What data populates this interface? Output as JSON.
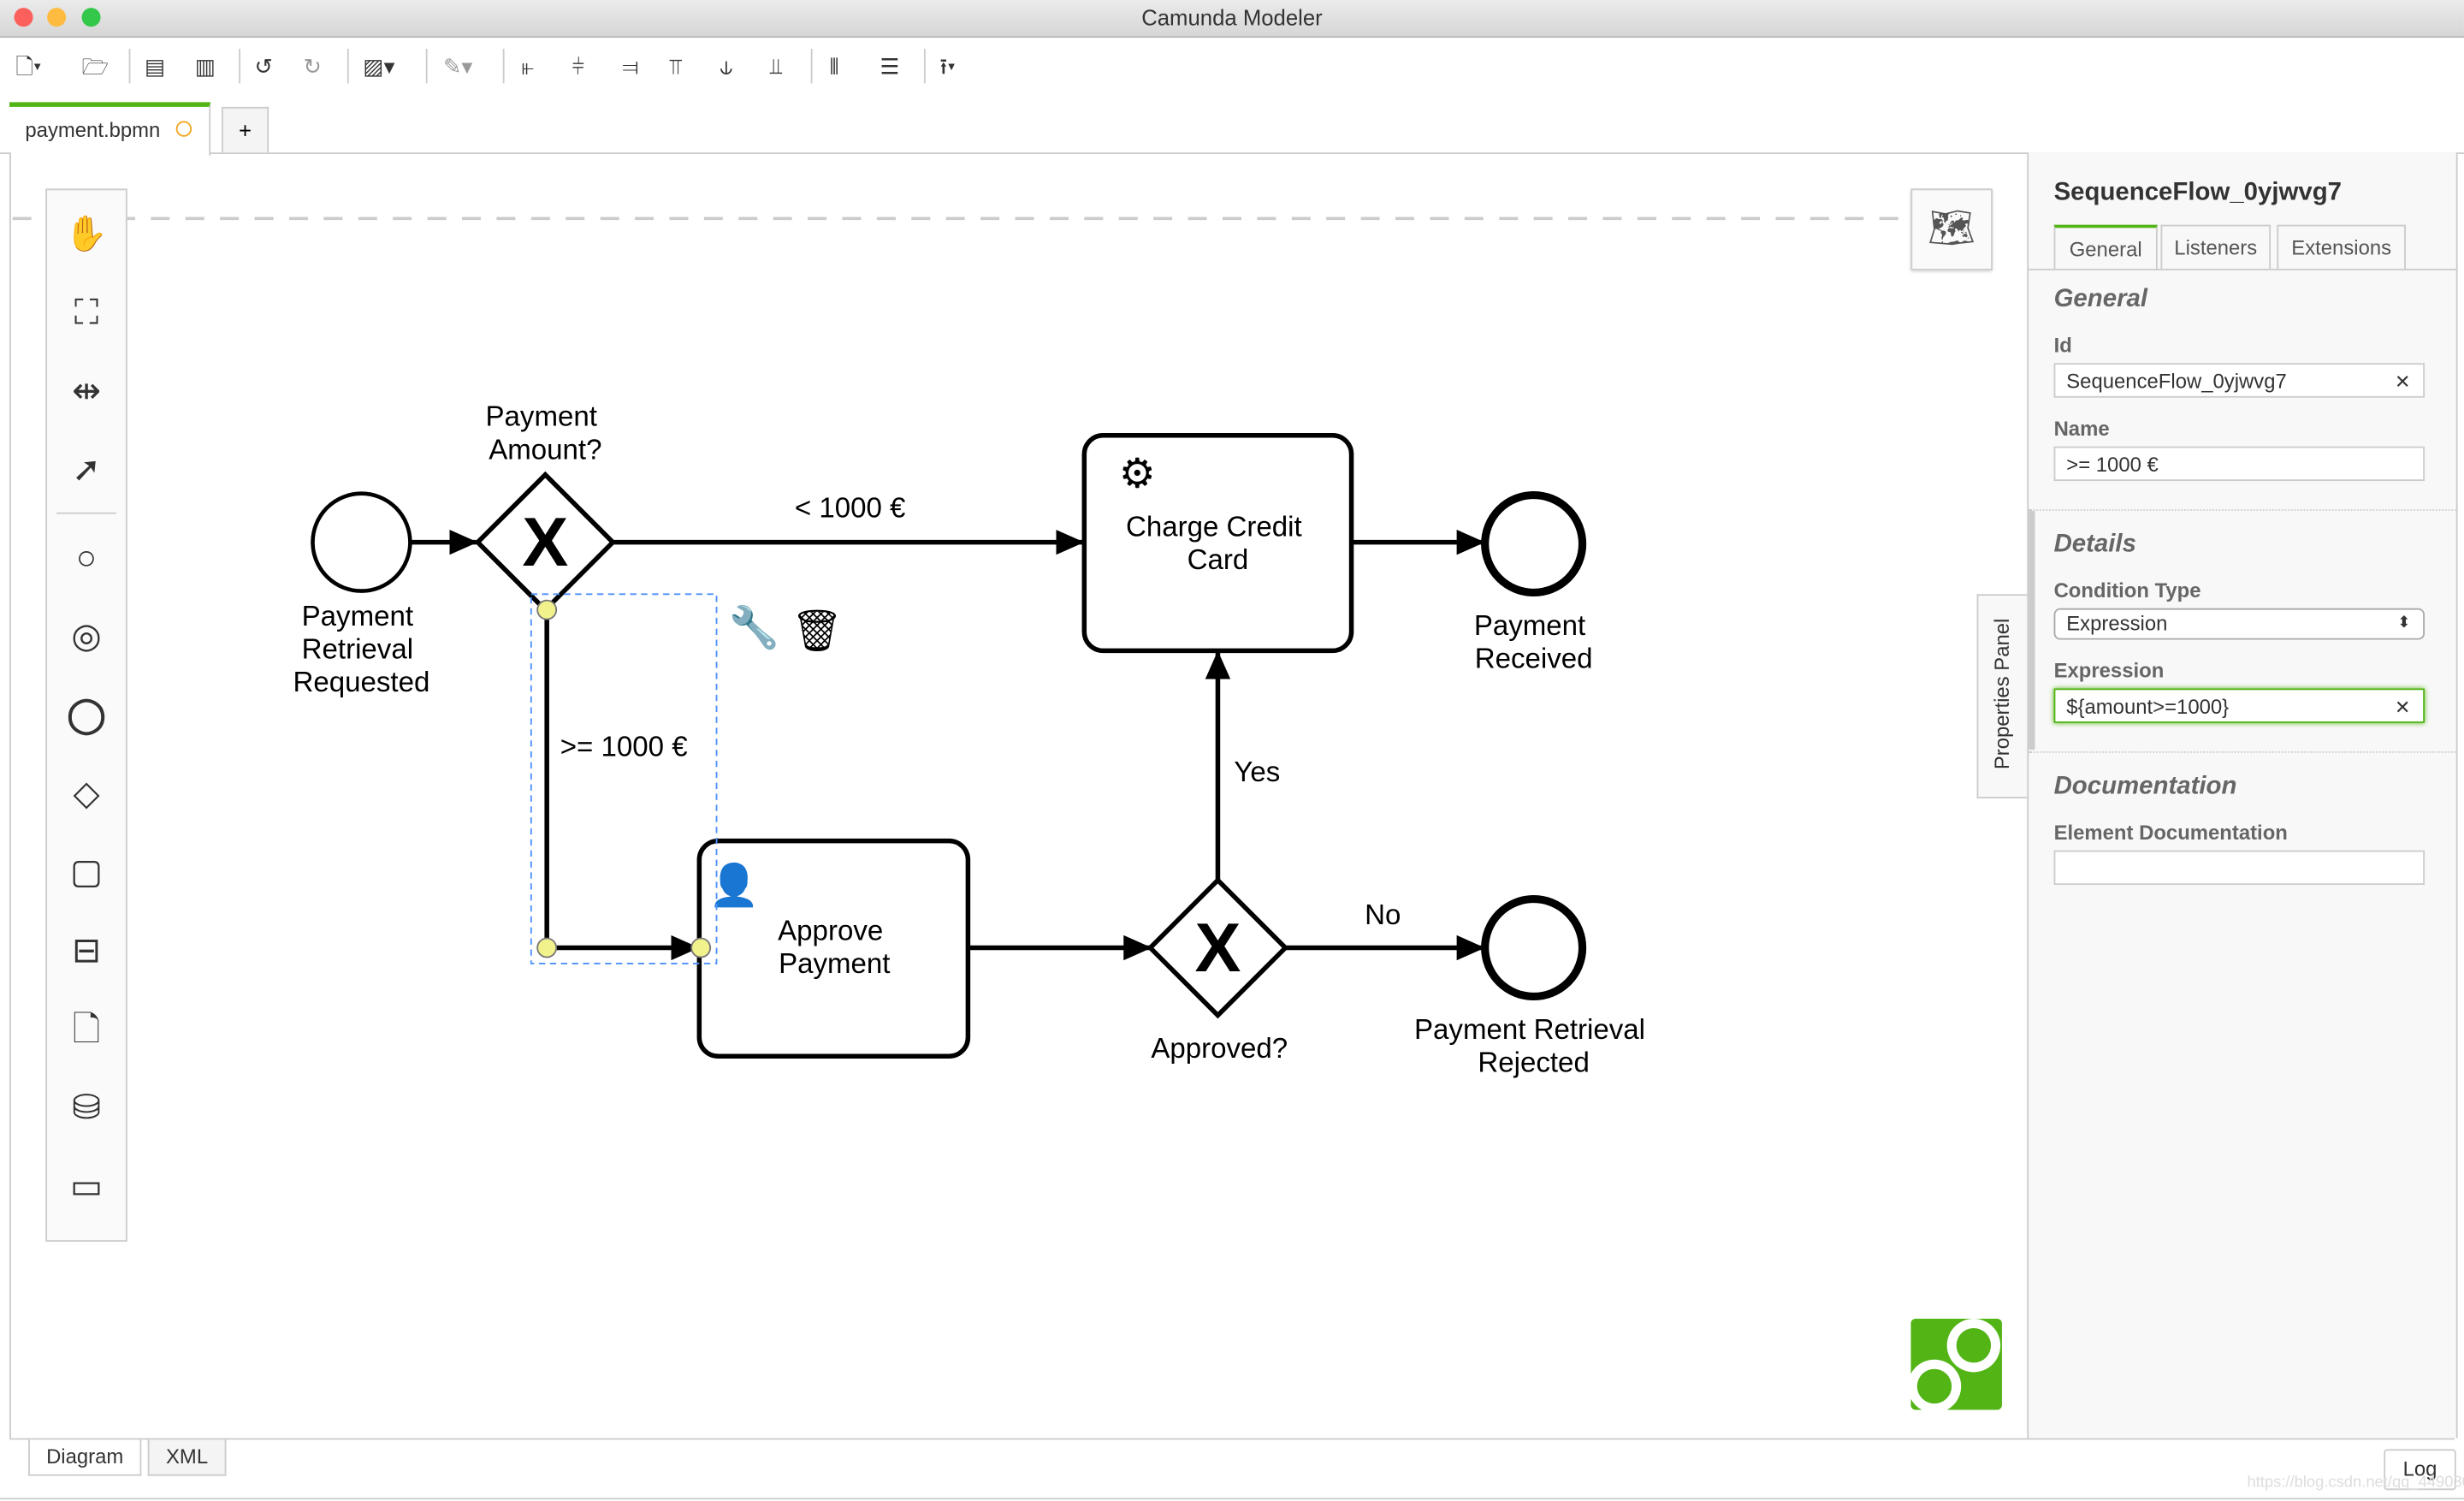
{
  "window": {
    "title": "Camunda Modeler"
  },
  "toolbar": {
    "icons": [
      "new-file-icon",
      "open-folder-icon",
      "save-icon",
      "save-as-icon",
      "undo-icon",
      "redo-icon",
      "export-image-icon",
      "color-brush-icon",
      "align-left-icon",
      "align-center-icon",
      "align-right-icon",
      "align-top-icon",
      "align-middle-icon",
      "align-bottom-icon",
      "distribute-horizontal-icon",
      "distribute-vertical-icon",
      "deploy-icon"
    ]
  },
  "tabs": {
    "file": "payment.bpmn",
    "add": "+"
  },
  "diagram": {
    "start_event": "Payment Retrieval Requested",
    "gateway_amount": "Payment Amount?",
    "flow_low": "< 1000 €",
    "flow_high": ">= 1000 €",
    "task_charge": "Charge Credit Card",
    "end_received": "Payment Received",
    "task_approve": "Approve Payment",
    "gateway_approved": "Approved?",
    "flow_yes": "Yes",
    "flow_no": "No",
    "end_rejected": "Payment Retrieval Rejected"
  },
  "properties": {
    "title": "SequenceFlow_0yjwvg7",
    "tabs": [
      "General",
      "Listeners",
      "Extensions"
    ],
    "active_tab": "General",
    "toggle_label": "Properties Panel",
    "general": {
      "heading": "General",
      "id_label": "Id",
      "id_value": "SequenceFlow_0yjwvg7",
      "name_label": "Name",
      "name_value": ">= 1000 €"
    },
    "details": {
      "heading": "Details",
      "condition_type_label": "Condition Type",
      "condition_type_value": "Expression",
      "expression_label": "Expression",
      "expression_value": "${amount>=1000}"
    },
    "documentation": {
      "heading": "Documentation",
      "element_doc_label": "Element Documentation",
      "element_doc_value": ""
    }
  },
  "bottom": {
    "tabs": [
      "Diagram",
      "XML"
    ],
    "log": "Log",
    "watermark": "https://blog.csdn.net/qq_44903056"
  },
  "colors": {
    "accent": "#52b415",
    "selection": "#4d90fe",
    "handle": "#f2f28c"
  }
}
